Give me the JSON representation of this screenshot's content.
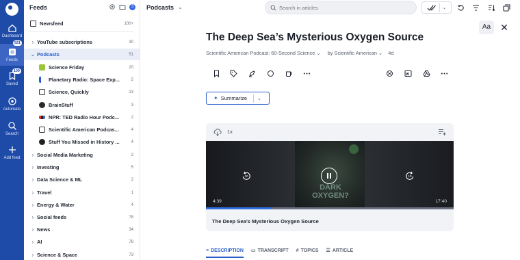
{
  "rail": {
    "items": [
      {
        "label": "Dashboard",
        "icon": "dashboard-icon"
      },
      {
        "label": "Feeds",
        "icon": "feeds-icon",
        "badge": "521"
      },
      {
        "label": "Saved",
        "icon": "bookmark-icon",
        "badge": "100"
      },
      {
        "label": "Automate",
        "icon": "automate-icon"
      },
      {
        "label": "Search",
        "icon": "search-icon"
      },
      {
        "label": "Add feed",
        "icon": "plus-icon"
      }
    ]
  },
  "feeds": {
    "header": "Feeds",
    "unread_dot": "3",
    "newsfeed": {
      "label": "Newsfeed",
      "count": "100+"
    },
    "items": [
      {
        "label": "YouTube subscriptions",
        "count": "30"
      },
      {
        "label": "Podcasts",
        "count": "51"
      },
      {
        "label": "Science Friday",
        "count": "20"
      },
      {
        "label": "Planetary Radio: Space Exp...",
        "count": "5"
      },
      {
        "label": "Science, Quickly",
        "count": "13"
      },
      {
        "label": "BrainStuff",
        "count": "3"
      },
      {
        "label": "NPR: TED Radio Hour Podc...",
        "count": "2"
      },
      {
        "label": "Scientific American Podcas...",
        "count": "4"
      },
      {
        "label": "Stuff You Missed in History ...",
        "count": "4"
      },
      {
        "label": "Social Media Marketing",
        "count": "2"
      },
      {
        "label": "Investing",
        "count": "5"
      },
      {
        "label": "Data Science & ML",
        "count": "2"
      },
      {
        "label": "Travel",
        "count": "1"
      },
      {
        "label": "Energy & Water",
        "count": "4"
      },
      {
        "label": "Social feeds",
        "count": "78"
      },
      {
        "label": "News",
        "count": "34"
      },
      {
        "label": "AI",
        "count": "78"
      },
      {
        "label": "Science & Space",
        "count": "73"
      }
    ]
  },
  "topbar": {
    "title": "Podcasts",
    "search_placeholder": "Search in articles"
  },
  "article": {
    "title": "The Deep Sea’s Mysterious Oxygen Source",
    "source": "Scientific American Podcast: 60-Second Science",
    "author": "by Scientific American",
    "age": "4d",
    "font_button": "Aa",
    "summarize_label": "Summarize"
  },
  "player": {
    "speed": "1x",
    "current_time": "4:39",
    "total_time": "17:40",
    "progress_fraction": 0.263,
    "video_overlay_text": "DARK OXYGEN?",
    "episode_title": "The Deep Sea’s Mysterious Oxygen Source"
  },
  "tabs": [
    {
      "label": "DESCRIPTION",
      "icon": "lines-icon",
      "active": true
    },
    {
      "label": "TRANSCRIPT",
      "icon": "keyboard-icon",
      "active": false
    },
    {
      "label": "TOPICS",
      "icon": "hash-icon",
      "active": false
    },
    {
      "label": "ARTICLE",
      "icon": "list-icon",
      "active": false
    }
  ],
  "colors": {
    "rail": "#1e4aa8",
    "accent": "#2a5fc9",
    "selected_row": "#e8edf7",
    "progress": "#2f6fe0"
  }
}
